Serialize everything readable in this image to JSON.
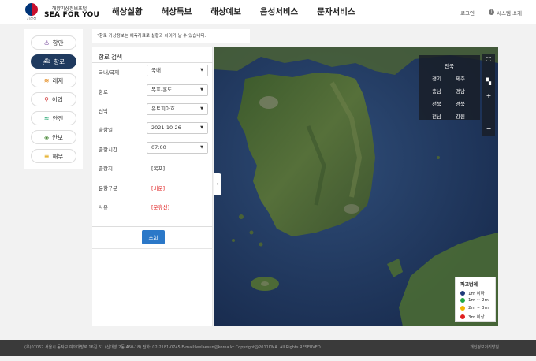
{
  "header": {
    "logo_sub": "해양기상정보포털",
    "logo_main": "SEA FOR YOU",
    "logo_org": "기상청",
    "nav": [
      "해상실황",
      "해상특보",
      "해상예보",
      "음성서비스",
      "문자서비스"
    ],
    "login": "로그인",
    "system_intro": "시스템 소개"
  },
  "sidebar": {
    "items": [
      {
        "label": "항만",
        "icon": "anchor-icon",
        "glyph": "⚓",
        "color": "#7b4fa0"
      },
      {
        "label": "항로",
        "icon": "ship-icon",
        "glyph": "⛴",
        "color": "#ffffff"
      },
      {
        "label": "레저",
        "icon": "leisure-icon",
        "glyph": "≋",
        "color": "#e07b00"
      },
      {
        "label": "어업",
        "icon": "fishing-icon",
        "glyph": "⚲",
        "color": "#d23c3c"
      },
      {
        "label": "안전",
        "icon": "safety-icon",
        "glyph": "≈",
        "color": "#1aa36b"
      },
      {
        "label": "안보",
        "icon": "shield-icon",
        "glyph": "◈",
        "color": "#4a8a3a"
      },
      {
        "label": "해무",
        "icon": "fog-icon",
        "glyph": "≡",
        "color": "#e0a000"
      }
    ],
    "active": 1
  },
  "notice": "*항로 기상정보는 예측자료로 실황과 차이가 날 수 있습니다.",
  "search": {
    "title": "항로 검색",
    "rows": [
      {
        "label": "국내/국제",
        "value": "국내"
      },
      {
        "label": "항로",
        "value": "목포-홍도"
      },
      {
        "label": "선박",
        "value": "유토피아호"
      },
      {
        "label": "출항일",
        "value": "2021-10-26"
      },
      {
        "label": "출항시간",
        "value": "07:00"
      }
    ],
    "info_rows": [
      {
        "label": "출항지",
        "value": "[목포]",
        "color": "#333333"
      },
      {
        "label": "운항구분",
        "value": "[비운]",
        "color": "#e02020"
      },
      {
        "label": "사유",
        "value": "[운휴선]",
        "color": "#e02020"
      }
    ],
    "button": "조회"
  },
  "map": {
    "regions_all": "전국",
    "regions": [
      [
        "경기",
        "제주"
      ],
      [
        "충남",
        "경남"
      ],
      [
        "전북",
        "경북"
      ],
      [
        "전남",
        "강원"
      ]
    ],
    "legend": {
      "title": "파고범례",
      "items": [
        {
          "label": "1m 이하",
          "color": "#1f3a7a"
        },
        {
          "label": "1m ~ 2m",
          "color": "#22a844"
        },
        {
          "label": "2m ~ 3m",
          "color": "#f2b600"
        },
        {
          "label": "3m 이상",
          "color": "#e02020"
        }
      ]
    }
  },
  "footer": {
    "address": "(우)07062 서울시 동작구 여의대방로 16길 61 (신대방 2동 460-18)     전화: 02-2181-0745     E-mail:leelaesun@korea.kr     Copyright@2011KMA. All Rights RESERVED.",
    "privacy": "개인정보처리방침"
  }
}
